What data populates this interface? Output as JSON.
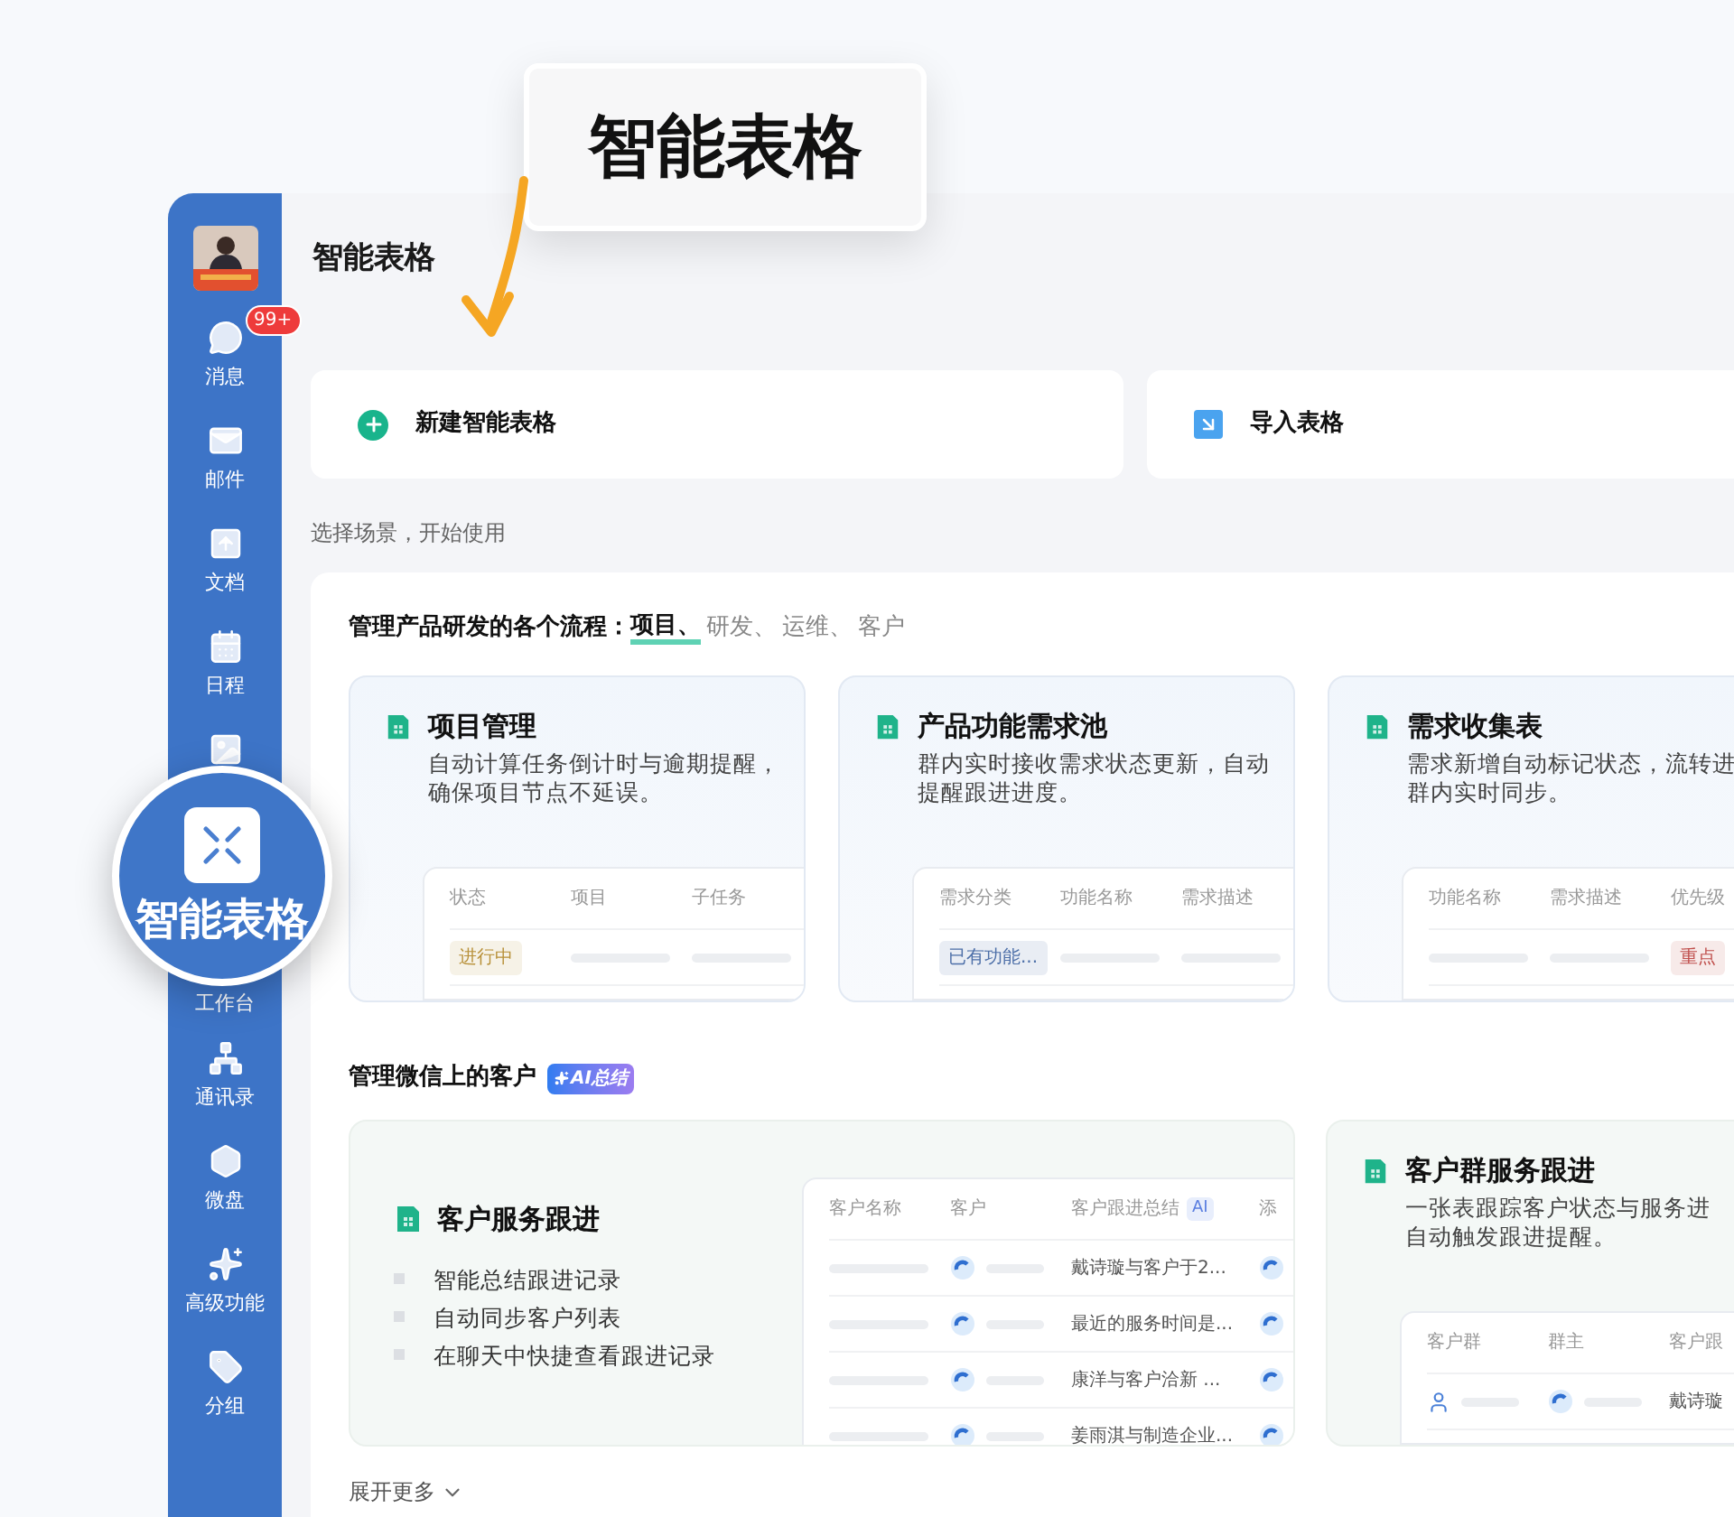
{
  "callout": {
    "label": "智能表格"
  },
  "sidebar": {
    "items": [
      {
        "kind": "nav",
        "label": "消息",
        "badge": "99+"
      },
      {
        "kind": "nav",
        "label": "邮件"
      },
      {
        "kind": "nav",
        "label": "文档"
      },
      {
        "kind": "nav",
        "label": "日程"
      },
      {
        "kind": "icon_only"
      },
      {
        "kind": "label_only",
        "label": "工作台"
      },
      {
        "kind": "nav",
        "label": "通讯录"
      },
      {
        "kind": "nav",
        "label": "微盘"
      },
      {
        "kind": "nav",
        "label": "高级功能"
      },
      {
        "kind": "nav",
        "label": "分组"
      }
    ]
  },
  "magnifier": {
    "label": "智能表格"
  },
  "page_title": "智能表格",
  "actions": [
    {
      "label": "新建智能表格"
    },
    {
      "label": "导入表格"
    }
  ],
  "scene_hint": "选择场景，开始使用",
  "section_1": {
    "heading": "管理产品研发的各个流程：",
    "tabs": [
      {
        "label": "项目、",
        "selected": true
      },
      {
        "label": "研发、",
        "selected": false
      },
      {
        "label": "运维、",
        "selected": false
      },
      {
        "label": "客户",
        "selected": false
      }
    ],
    "cards": [
      {
        "title": "项目管理",
        "description": [
          "自动计算任务倒计时与逾期提醒，",
          "确保项目节点不延误。"
        ],
        "table": {
          "columns": [
            {
              "label": "状态"
            },
            {
              "label": "项目"
            },
            {
              "label": "子任务"
            }
          ],
          "rows": [
            [
              {
                "kind": "tag",
                "text": "进行中",
                "color": "#b8913a"
              },
              {
                "kind": "bar"
              },
              {
                "kind": "bar"
              }
            ]
          ]
        }
      },
      {
        "title": "产品功能需求池",
        "description": [
          "群内实时接收需求状态更新，自动",
          "提醒跟进进度。"
        ],
        "table": {
          "columns": [
            {
              "label": "需求分类"
            },
            {
              "label": "功能名称"
            },
            {
              "label": "需求描述"
            }
          ],
          "rows": [
            [
              {
                "kind": "tag",
                "text": "已有功能...",
                "color": "#4d6fa8"
              },
              {
                "kind": "bar"
              },
              {
                "kind": "bar"
              }
            ]
          ]
        }
      },
      {
        "title": "需求收集表",
        "description": [
          "需求新增自动标记状态，流转进",
          "群内实时同步。"
        ],
        "table": {
          "columns": [
            {
              "label": "功能名称"
            },
            {
              "label": "需求描述"
            },
            {
              "label": "优先级"
            }
          ],
          "rows": [
            [
              {
                "kind": "bar"
              },
              {
                "kind": "bar"
              },
              {
                "kind": "tag",
                "text": "重点",
                "color": "#c0504d"
              }
            ]
          ]
        }
      }
    ]
  },
  "section_2": {
    "heading": "管理微信上的客户",
    "badge": "AI总结",
    "feature": {
      "title": "客户服务跟进",
      "bullets": [
        "智能总结跟进记录",
        "自动同步客户列表",
        "在聊天中快捷查看跟进记录"
      ],
      "table": {
        "columns": [
          {
            "label": "客户名称"
          },
          {
            "label": "客户"
          },
          {
            "label": "客户跟进总结",
            "badge": "AI"
          },
          {
            "label": "添"
          }
        ],
        "rows": [
          [
            {
              "kind": "bar"
            },
            {
              "kind": "avatar_bar"
            },
            {
              "kind": "text",
              "text": "戴诗璇与客户于2..."
            },
            {
              "kind": "avatar"
            }
          ],
          [
            {
              "kind": "bar"
            },
            {
              "kind": "avatar_bar"
            },
            {
              "kind": "text",
              "text": "最近的服务时间是..."
            },
            {
              "kind": "avatar"
            }
          ],
          [
            {
              "kind": "bar"
            },
            {
              "kind": "avatar_bar"
            },
            {
              "kind": "text",
              "text": "康洋与客户洽新 ..."
            },
            {
              "kind": "avatar"
            }
          ],
          [
            {
              "kind": "bar"
            },
            {
              "kind": "avatar_bar"
            },
            {
              "kind": "text",
              "text": "姜雨淇与制造企业..."
            },
            {
              "kind": "avatar"
            }
          ]
        ]
      }
    },
    "cards": [
      {
        "title": "客户群服务跟进",
        "description": [
          "一张表跟踪客户状态与服务进",
          "自动触发跟进提醒。"
        ],
        "table": {
          "columns": [
            {
              "label": "客户群"
            },
            {
              "label": "群主"
            },
            {
              "label": "客户跟"
            }
          ],
          "rows": [
            [
              {
                "kind": "person_bar"
              },
              {
                "kind": "avatar_bar"
              },
              {
                "kind": "text",
                "text": "戴诗璇"
              }
            ]
          ]
        }
      }
    ]
  },
  "expand": {
    "label": "展开更多"
  }
}
